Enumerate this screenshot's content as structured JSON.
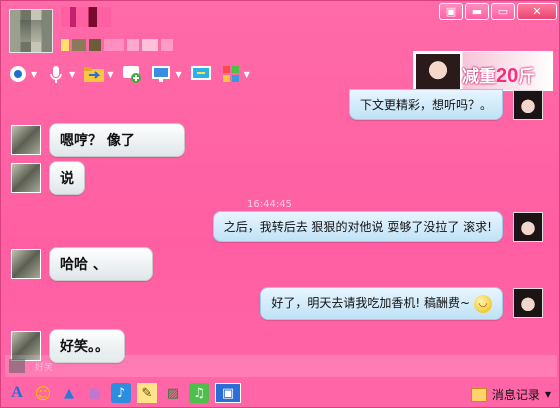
{
  "window": {
    "controls": {
      "menu": "▣",
      "minimize": "▬",
      "maximize": "▭",
      "close": "✕"
    }
  },
  "toolbar": {
    "items": [
      {
        "icon": "video-camera-icon"
      },
      {
        "icon": "microphone-icon"
      },
      {
        "icon": "folder-transfer-icon"
      },
      {
        "icon": "message-plus-icon"
      },
      {
        "icon": "remote-desktop-icon"
      },
      {
        "icon": "screen-share-icon"
      },
      {
        "icon": "apps-grid-icon"
      }
    ]
  },
  "ad": {
    "text": "减重",
    "number": "20",
    "unit": "斤"
  },
  "chat": {
    "timestamp": "16:44:45",
    "messages": [
      {
        "side": "right",
        "text": "下文更精彩，想听吗？。"
      },
      {
        "side": "left",
        "text": "嗯哼？      像了"
      },
      {
        "side": "left",
        "text": "说"
      },
      {
        "side": "right",
        "text": "之后，我转后去 狠狠的对他说  耍够了没拉了  滚求!"
      },
      {
        "side": "left",
        "text": "哈哈       、"
      },
      {
        "side": "right",
        "text": "好了，明天去请我吃加香机!       稿酬费~"
      },
      {
        "side": "left",
        "text": "好笑。。"
      }
    ]
  },
  "input": {
    "preview_text": "好笑"
  },
  "bottom": {
    "tools": [
      {
        "icon": "font-icon",
        "glyph": "A"
      },
      {
        "icon": "emoticon-icon",
        "glyph": "☺"
      },
      {
        "icon": "shake-icon",
        "glyph": "▲"
      },
      {
        "icon": "gift-icon",
        "glyph": "▦"
      },
      {
        "icon": "voice-message-icon",
        "glyph": "♪"
      },
      {
        "icon": "note-icon",
        "glyph": "✎"
      },
      {
        "icon": "image-icon",
        "glyph": "▨"
      },
      {
        "icon": "music-icon",
        "glyph": "♫"
      },
      {
        "icon": "screenshot-icon",
        "glyph": "▣"
      }
    ],
    "history_label": "消息记录"
  },
  "colors": {
    "background": "#ff5fa2",
    "bubble_left": "#ffffff",
    "bubble_right": "#d6edfb"
  }
}
